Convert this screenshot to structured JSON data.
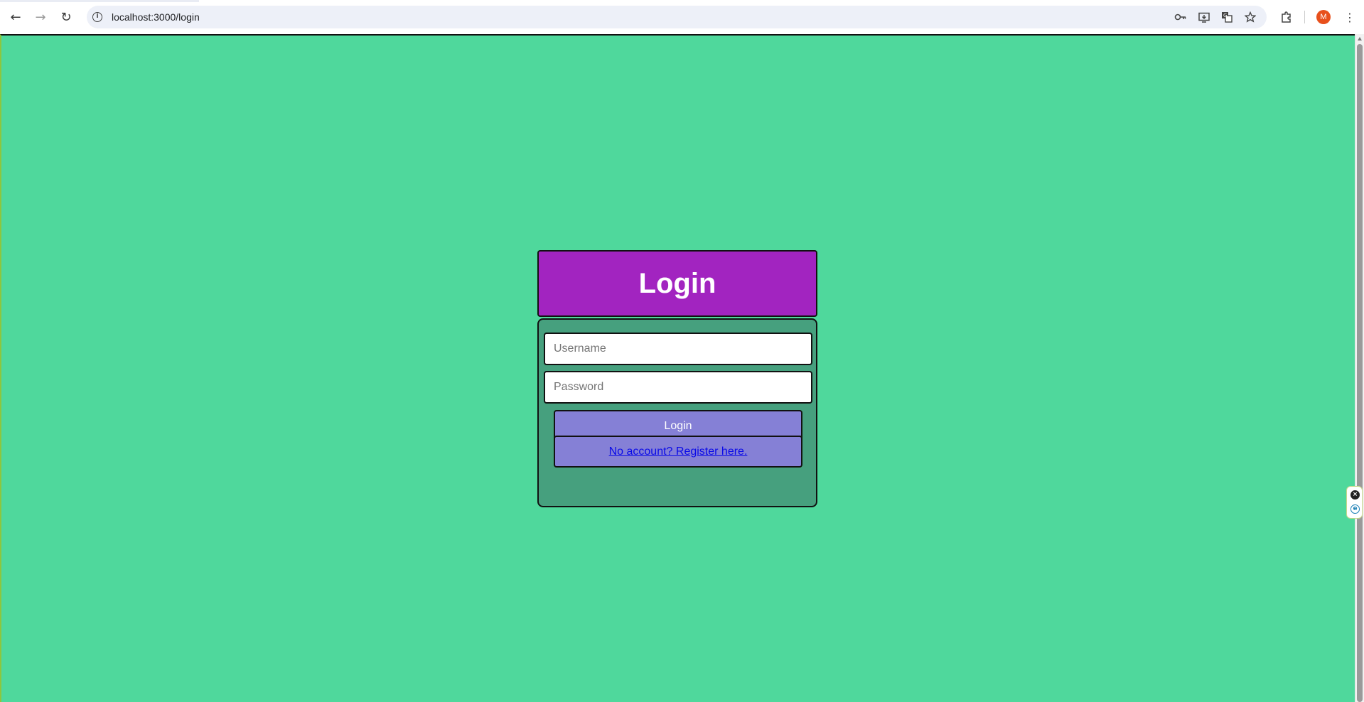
{
  "browser": {
    "back_glyph": "←",
    "forward_glyph": "→",
    "reload_glyph": "↻",
    "info_glyph": "i",
    "url": "localhost:3000/login",
    "avatar_letter": "M",
    "menu_glyph": "⋮"
  },
  "page": {
    "background_color": "#4fd89c",
    "header": {
      "title": "Login",
      "color": "#a224c0"
    },
    "form": {
      "color": "#46a07e",
      "username_placeholder": "Username",
      "password_placeholder": "Password",
      "login_button_label": "Login",
      "register_link_label": "No account? Register here.",
      "button_color": "#8580d6"
    }
  },
  "extension_widget": {
    "close_glyph": "×",
    "e_glyph": "e"
  }
}
